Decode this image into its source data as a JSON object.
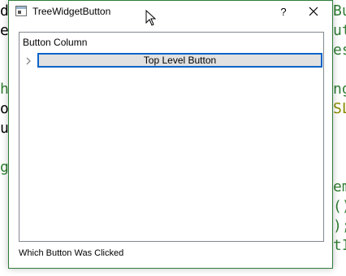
{
  "window": {
    "title": "TreeWidgetButton",
    "help_label": "?"
  },
  "tree": {
    "column_header": "Button Column",
    "rows": [
      {
        "button_label": "Top Level Button"
      }
    ]
  },
  "status": {
    "label": "Which Button Was Clicked"
  },
  "background_code": {
    "left": [
      "d",
      "e",
      "h",
      "o",
      "u",
      "g"
    ],
    "right": [
      "Bu",
      "ut",
      "es",
      "ng",
      "SL",
      "em",
      "()",
      ");",
      "tI"
    ]
  },
  "colors": {
    "window_border": "#2f7d3a",
    "focus_blue": "#0a64c8",
    "button_face": "#e1e1e1",
    "code_black": "#000000",
    "code_green": "#2e7d32",
    "code_olive": "#8a8a00"
  },
  "icons": {
    "app": "window-app-icon",
    "close": "close-icon",
    "expand": "chevron-right-icon",
    "cursor": "mouse-pointer-icon"
  }
}
